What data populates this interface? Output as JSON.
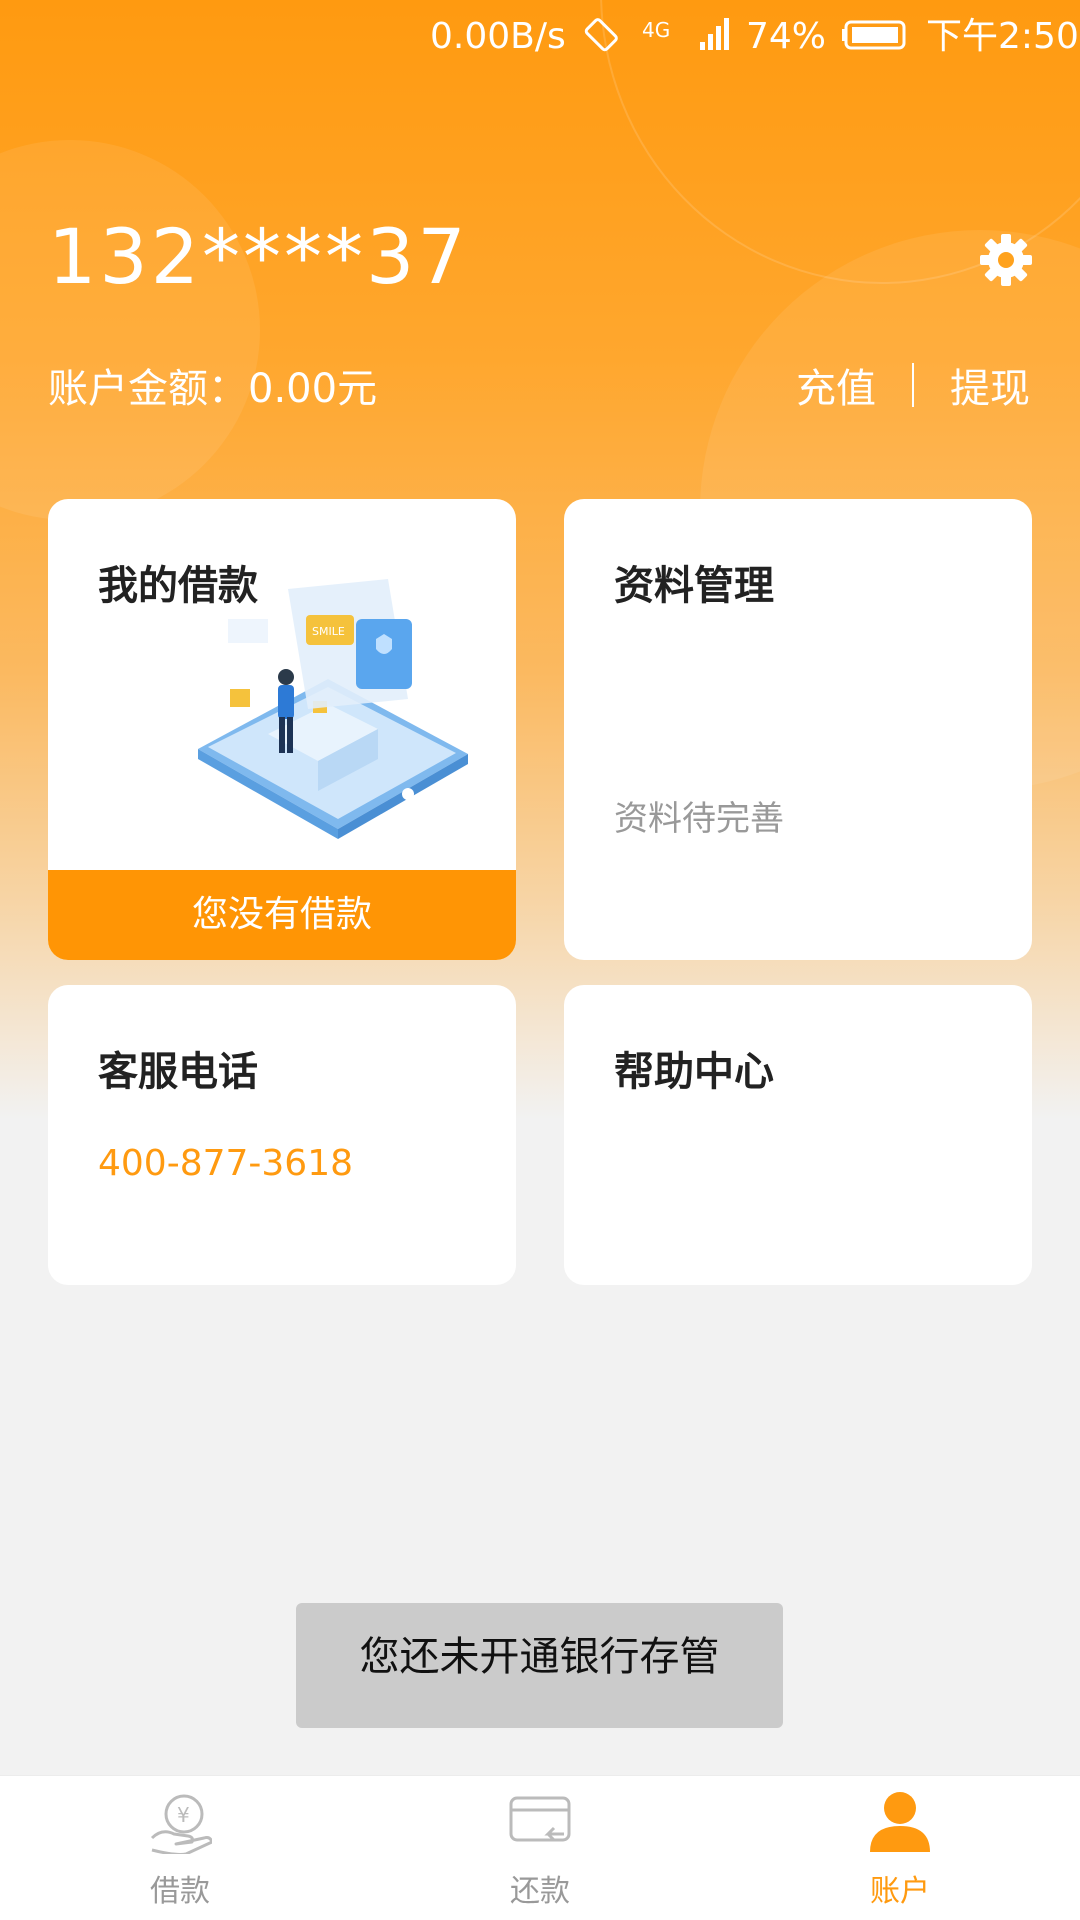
{
  "status_bar": {
    "speed": "0.00B/s",
    "network": "4G",
    "battery": "74%",
    "time": "下午2:50"
  },
  "header": {
    "account_number": "132****37",
    "balance_label": "账户金额：",
    "balance_value": "0.00元",
    "recharge_label": "充值",
    "withdraw_label": "提现",
    "settings_icon": "gear-icon"
  },
  "cards": {
    "loans": {
      "title": "我的借款",
      "status": "您没有借款",
      "illustration_text": "SMILE"
    },
    "profile": {
      "title": "资料管理",
      "status": "资料待完善"
    },
    "service": {
      "title": "客服电话",
      "phone": "400-877-3618"
    },
    "help": {
      "title": "帮助中心"
    }
  },
  "toast": {
    "message": "您还未开通银行存管"
  },
  "bottom_nav": {
    "items": [
      {
        "label": "借款",
        "icon": "loan-hand-icon",
        "active": false
      },
      {
        "label": "还款",
        "icon": "card-repay-icon",
        "active": false
      },
      {
        "label": "账户",
        "icon": "user-icon",
        "active": true
      }
    ]
  },
  "colors": {
    "brand_orange": "#ff9a10",
    "footer_orange": "#ff9505",
    "background": "#f2f2f2",
    "inactive_gray": "#999999"
  }
}
